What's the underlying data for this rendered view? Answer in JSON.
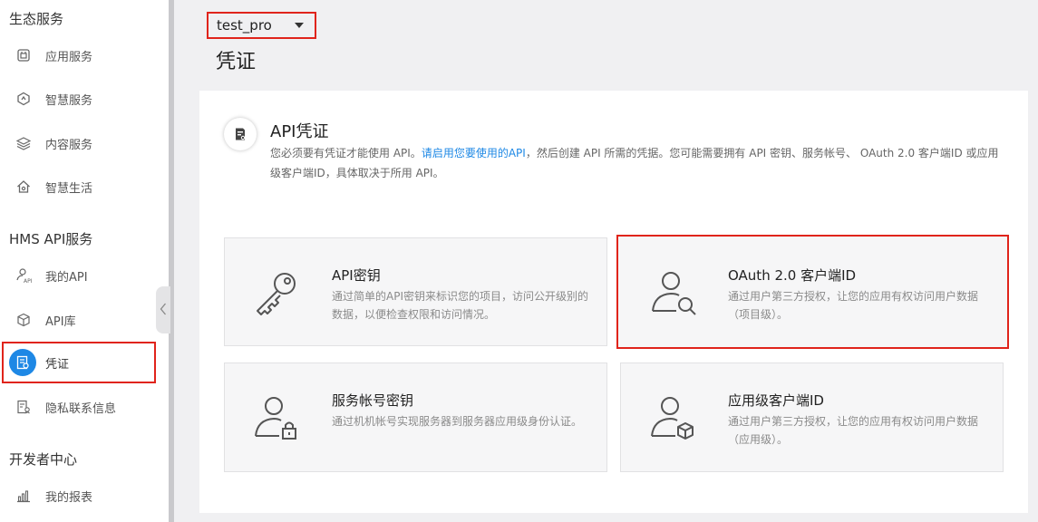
{
  "sidebar": {
    "sections": [
      {
        "title": "生态服务"
      },
      {
        "title": "HMS API服务"
      },
      {
        "title": "开发者中心"
      }
    ],
    "items": [
      {
        "label": "应用服务",
        "icon": "app-service-icon"
      },
      {
        "label": "智慧服务",
        "icon": "smart-service-icon"
      },
      {
        "label": "内容服务",
        "icon": "content-service-icon"
      },
      {
        "label": "智慧生活",
        "icon": "smart-life-icon"
      },
      {
        "label": "我的API",
        "icon": "my-api-icon"
      },
      {
        "label": "API库",
        "icon": "api-library-icon"
      },
      {
        "label": "凭证",
        "icon": "credential-icon",
        "active": true
      },
      {
        "label": "隐私联系信息",
        "icon": "privacy-contact-icon"
      },
      {
        "label": "我的报表",
        "icon": "report-chart-icon"
      }
    ]
  },
  "project": {
    "selected": "test_pro"
  },
  "page": {
    "title": "凭证"
  },
  "panel": {
    "title": "API凭证",
    "desc_before": "您必须要有凭证才能使用 API。",
    "desc_link": "请启用您要使用的API",
    "desc_after": "，然后创建 API 所需的凭据。您可能需要拥有 API 密钥、服务帐号、 OAuth 2.0 客户端ID 或应用级客户端ID，具体取决于所用 API。"
  },
  "cards": [
    {
      "title": "API密钥",
      "desc": "通过简单的API密钥来标识您的项目，访问公开级别的数据，以便检查权限和访问情况。",
      "icon": "key-icon"
    },
    {
      "title": "OAuth 2.0 客户端ID",
      "desc": "通过用户第三方授权，让您的应用有权访问用户数据（项目级）。",
      "icon": "user-search-icon",
      "selected": true
    },
    {
      "title": "服务帐号密钥",
      "desc": "通过机机帐号实现服务器到服务器应用级身份认证。",
      "icon": "user-lock-icon"
    },
    {
      "title": "应用级客户端ID",
      "desc": "通过用户第三方授权，让您的应用有权访问用户数据（应用级）。",
      "icon": "user-cube-icon"
    }
  ],
  "colors": {
    "accent": "#1e88e5",
    "highlight": "#e0241b"
  }
}
